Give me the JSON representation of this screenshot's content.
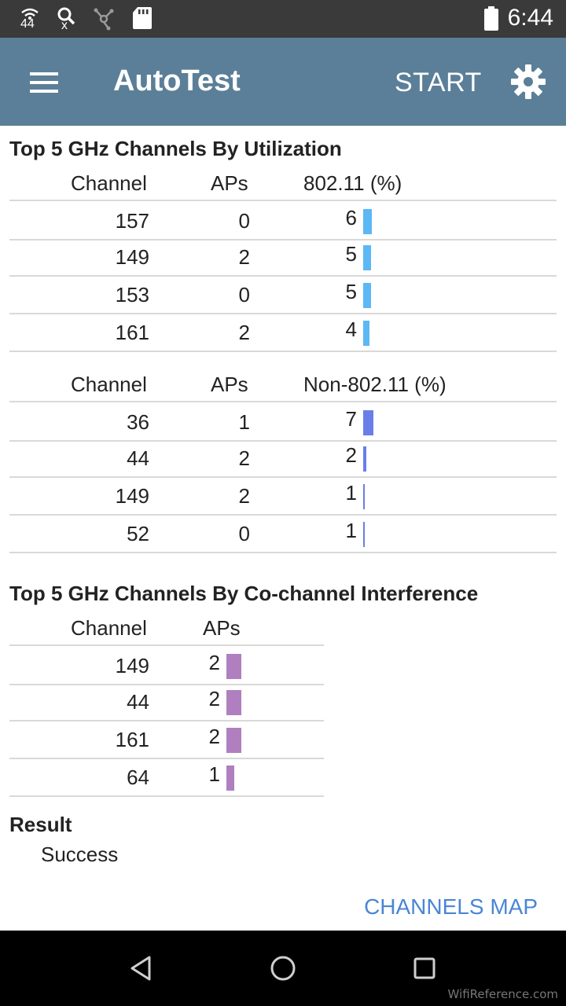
{
  "status_bar": {
    "signal_text": "44",
    "search_text": "x",
    "time": "6:44"
  },
  "app_bar": {
    "title": "AutoTest",
    "start_label": "START"
  },
  "utilization": {
    "title": "Top 5 GHz Channels By Utilization",
    "table1": {
      "headers": {
        "channel": "Channel",
        "aps": "APs",
        "metric": "802.11 (%)"
      },
      "rows": [
        {
          "channel": "157",
          "aps": "0",
          "value": "6"
        },
        {
          "channel": "149",
          "aps": "2",
          "value": "5"
        },
        {
          "channel": "153",
          "aps": "0",
          "value": "5"
        },
        {
          "channel": "161",
          "aps": "2",
          "value": "4"
        }
      ],
      "bar_color": "#5cb8f5"
    },
    "table2": {
      "headers": {
        "channel": "Channel",
        "aps": "APs",
        "metric": "Non-802.11 (%)"
      },
      "rows": [
        {
          "channel": "36",
          "aps": "1",
          "value": "7"
        },
        {
          "channel": "44",
          "aps": "2",
          "value": "2"
        },
        {
          "channel": "149",
          "aps": "2",
          "value": "1"
        },
        {
          "channel": "52",
          "aps": "0",
          "value": "1"
        }
      ],
      "bar_color": "#6a7ee8"
    }
  },
  "interference": {
    "title": "Top 5 GHz Channels By Co-channel Interference",
    "headers": {
      "channel": "Channel",
      "aps": "APs"
    },
    "rows": [
      {
        "channel": "149",
        "aps": "2"
      },
      {
        "channel": "44",
        "aps": "2"
      },
      {
        "channel": "161",
        "aps": "2"
      },
      {
        "channel": "64",
        "aps": "1"
      }
    ],
    "bar_color": "#b07fc0"
  },
  "result": {
    "label": "Result",
    "value": "Success"
  },
  "channels_map_label": "CHANNELS MAP",
  "watermark": "WifiReference.com"
}
